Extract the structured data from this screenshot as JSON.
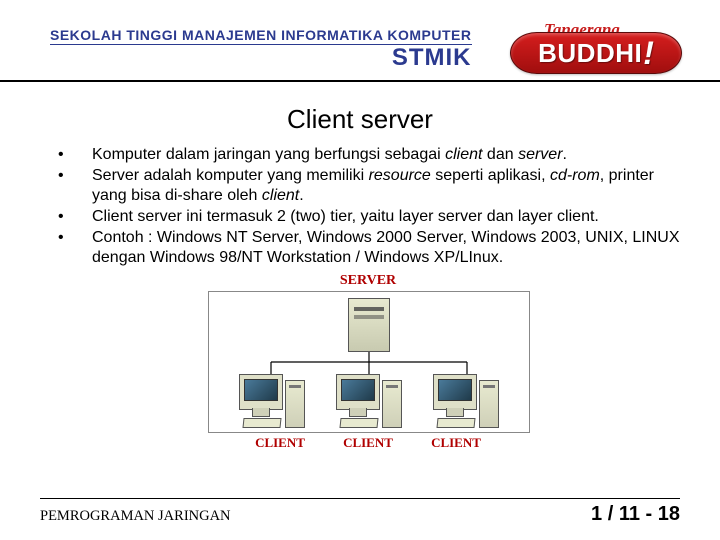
{
  "header": {
    "institution_line1": "SEKOLAH TINGGI MANAJEMEN INFORMATIKA KOMPUTER",
    "institution_line2": "STMIK",
    "logo_top": "Tangerang",
    "logo_main": "BUDDHI",
    "logo_excl": "!"
  },
  "title": "Client server",
  "bullets": [
    {
      "pre": "Komputer dalam jaringan yang berfungsi sebagai ",
      "em1": "client",
      "mid1": " dan ",
      "em2": "server",
      "post": "."
    },
    {
      "pre": "Server adalah komputer yang memiliki ",
      "em1": "resource",
      "mid1": " seperti aplikasi, ",
      "em2": "cd-rom",
      "mid2": ", printer yang bisa di-share oleh ",
      "em3": "client",
      "post": "."
    },
    {
      "pre": "Client server ini termasuk 2 (two) tier, yaitu layer server dan layer client."
    },
    {
      "pre": "Contoh : Windows NT Server, Windows 2000 Server, Windows 2003, UNIX, LINUX dengan Windows 98/NT Workstation / Windows XP/LInux."
    }
  ],
  "diagram": {
    "server_label": "SERVER",
    "client_label": "CLIENT"
  },
  "footer": {
    "left": "PEMROGRAMAN JARINGAN",
    "right": "1 / 11 - 18"
  }
}
